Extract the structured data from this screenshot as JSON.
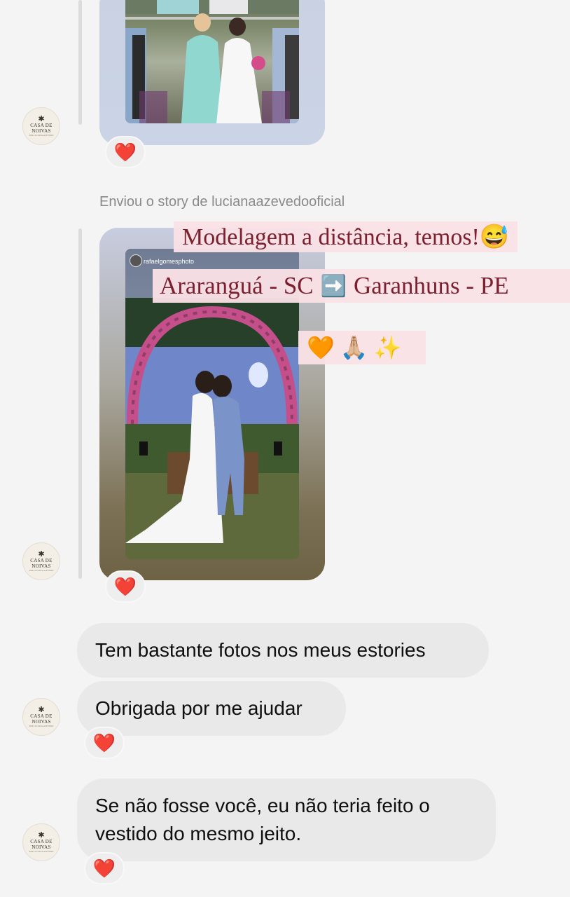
{
  "colors": {
    "heart": "#e4162f",
    "bubble": "#e9e9ea",
    "overlay_bg": "#fae2e6"
  },
  "avatar": {
    "line1": "CASA DE",
    "line2": "NOIVAS",
    "line3": "POR LUCIANA AZEVEDO",
    "icon": "star-icon"
  },
  "reactions": {
    "heart": "❤️"
  },
  "messages": {
    "story_label": "Enviou o story de lucianaazevedooficial",
    "story_username": "rafaelgomesphoto",
    "overlay_1": "Modelagem a distância, temos!😅",
    "overlay_2a": "Araranguá - SC",
    "overlay_2_arrow": "➡️",
    "overlay_2b": "Garanhuns - PE",
    "overlay_3": "🧡 🙏🏼 ✨",
    "msg_1": "Tem bastante fotos nos meus estories",
    "msg_2": "Obrigada por me ajudar",
    "msg_3_line1": "Se não fosse você, eu não teria feito o",
    "msg_3_line2": "vestido do mesmo jeito."
  }
}
